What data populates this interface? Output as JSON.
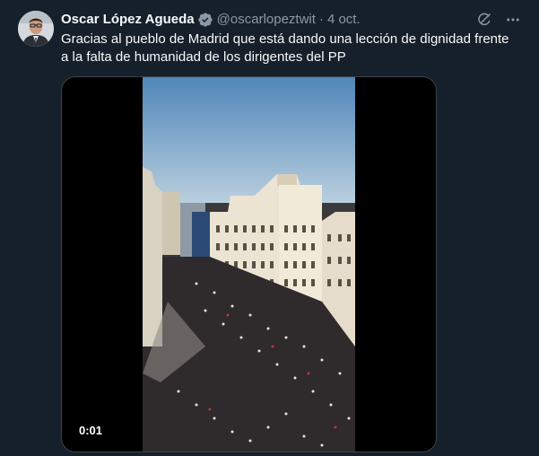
{
  "tweet": {
    "author_name": "Oscar López Agueda",
    "handle": "@oscarlopeztwit",
    "separator": "·",
    "date": "4 oct.",
    "text": "Gracias al pueblo de Madrid que está dando una lección de dignidad frente a la falta de humanidad de los dirigentes del PP",
    "verified_icon": "verified-badge-icon",
    "grok_icon": "grok-icon",
    "more_icon": "more-icon"
  },
  "media": {
    "timer": "0:01"
  },
  "colors": {
    "background": "#15202b",
    "text": "#f7f9f9",
    "secondary": "#8b98a5",
    "verified": "#1d9bf0"
  }
}
